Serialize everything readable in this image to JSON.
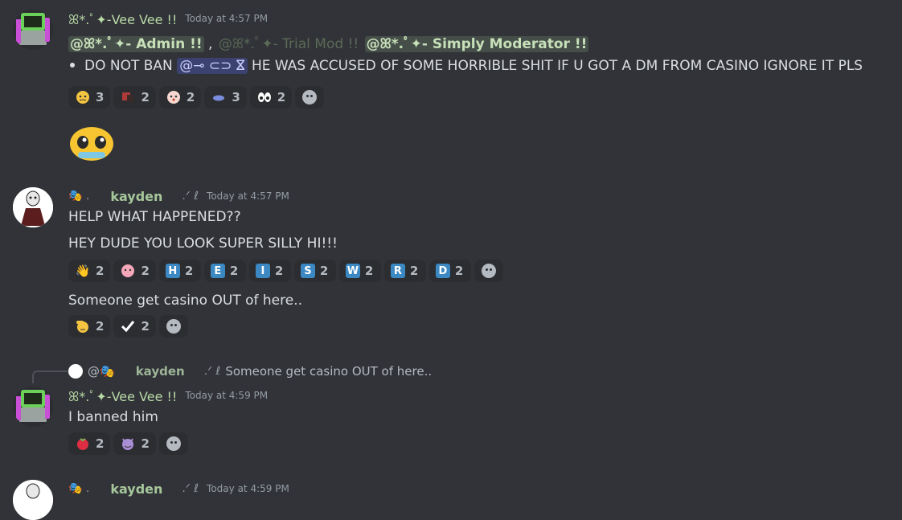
{
  "messages": [
    {
      "author": "ꕤ*.ﾟ✦-Vee Vee !!",
      "timestamp": "Today at 4:57 PM",
      "mentions_line": {
        "admin": "@ꕤ*.ﾟ✦- Admin !!",
        "sep": ",",
        "trial_mod": "@ꕤ*.ﾟ✦- Trial Mod !!",
        "simply_mod": "@ꕤ*.ﾟ✦- Simply Moderator !!"
      },
      "bullet_text_before": "DO NOT BAN",
      "user_mention": "@⊸ ⊂⊃ ⴵ",
      "bullet_text_after": "HE WAS ACCUSED OF SOME HORRIBLE SHIT IF U GOT A DM FROM CASINO IGNORE IT PLS",
      "reactions": [
        {
          "icon": "crying-face-emoji",
          "count": "3"
        },
        {
          "icon": "custom-character-emoji",
          "count": "2"
        },
        {
          "icon": "blushing-face-emoji",
          "count": "2"
        },
        {
          "icon": "blue-fish-emoji",
          "count": "3"
        },
        {
          "icon": "eyes-emoji",
          "count": "2"
        }
      ]
    },
    {
      "author": "kayden",
      "author_prefix": "🎭 .",
      "author_suffix": ".ᐟ ℓ",
      "timestamp": "Today at 4:57 PM",
      "line1": "HELP WHAT HAPPENED??",
      "line2": "HEY DUDE YOU LOOK SUPER SILLY HI!!!",
      "reactions": [
        {
          "icon": "waving-hand-emoji",
          "count": "2",
          "letter": "👋"
        },
        {
          "icon": "pink-face-emoji",
          "count": "2"
        },
        {
          "icon": "letter-h-emoji",
          "count": "2",
          "letter": "H"
        },
        {
          "icon": "letter-e-emoji",
          "count": "2",
          "letter": "E"
        },
        {
          "icon": "letter-i-emoji",
          "count": "2",
          "letter": "I"
        },
        {
          "icon": "letter-s-emoji",
          "count": "2",
          "letter": "S"
        },
        {
          "icon": "letter-w-emoji",
          "count": "2",
          "letter": "W"
        },
        {
          "icon": "letter-r-emoji",
          "count": "2",
          "letter": "R"
        },
        {
          "icon": "letter-d-emoji",
          "count": "2",
          "letter": "D"
        }
      ],
      "line3": "Someone get casino OUT of here..",
      "reactions2": [
        {
          "icon": "saluting-face-emoji",
          "count": "2"
        },
        {
          "icon": "check-mark-emoji",
          "count": "2"
        }
      ]
    },
    {
      "reply": {
        "at": "@🎭",
        "name": "kayden",
        "decor": ".ᐟ ℓ",
        "text": "Someone get casino OUT of here.."
      },
      "author": "ꕤ*.ﾟ✦-Vee Vee !!",
      "timestamp": "Today at 4:59 PM",
      "text": "I banned him",
      "reactions": [
        {
          "icon": "tomato-emoji",
          "count": "2"
        },
        {
          "icon": "smiling-devil-emoji",
          "count": "2"
        }
      ]
    },
    {
      "author": "kayden",
      "timestamp": "Today at 4:59 PM"
    }
  ],
  "colors": {
    "background": "#313338",
    "reaction_bg": "#2b2d31",
    "role_mention": "#c6e0b8",
    "user_mention_bg": "#3c4270"
  }
}
